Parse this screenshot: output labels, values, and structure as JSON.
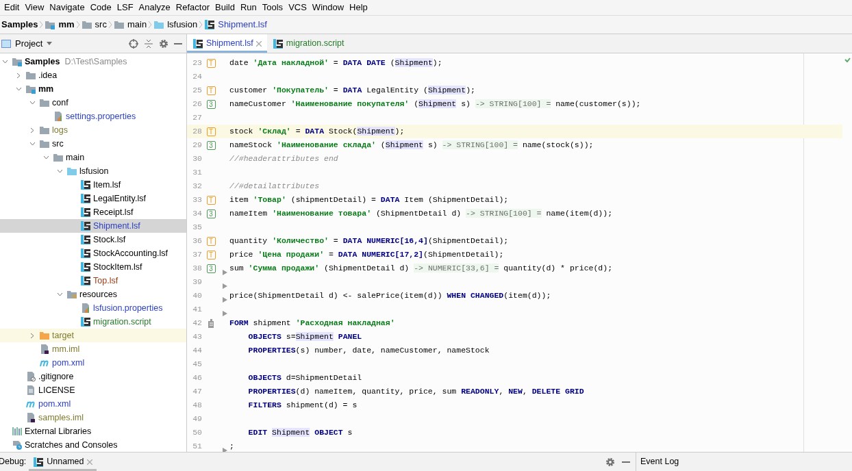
{
  "menu": [
    "Edit",
    "View",
    "Navigate",
    "Code",
    "LSF",
    "Analyze",
    "Refactor",
    "Build",
    "Run",
    "Tools",
    "VCS",
    "Window",
    "Help"
  ],
  "breadcrumbs": [
    {
      "label": "Samples",
      "kind": "plain",
      "bold": true
    },
    {
      "label": "mm",
      "kind": "module",
      "bold": true
    },
    {
      "label": "src",
      "kind": "folder",
      "bold": false
    },
    {
      "label": "main",
      "kind": "folder",
      "bold": false
    },
    {
      "label": "lsfusion",
      "kind": "source",
      "bold": false
    },
    {
      "label": "Shipment.lsf",
      "kind": "lsf",
      "bold": false
    }
  ],
  "project_panel": {
    "title": "Project",
    "tree": [
      {
        "label": "Samples",
        "path": "D:\\Test\\Samples",
        "kind": "module",
        "bold": true,
        "color": "#000000",
        "expanded": true,
        "selected": false,
        "excluded": false,
        "children": [
          {
            "label": ".idea",
            "kind": "folder",
            "bold": false,
            "color": "#000000",
            "expanded": false,
            "selected": false,
            "excluded": false
          },
          {
            "label": "mm",
            "kind": "module",
            "bold": true,
            "color": "#000000",
            "expanded": true,
            "selected": false,
            "excluded": false,
            "children": [
              {
                "label": "conf",
                "kind": "folder",
                "bold": false,
                "color": "#000000",
                "expanded": true,
                "selected": false,
                "excluded": false,
                "children": [
                  {
                    "label": "settings.properties",
                    "kind": "properties",
                    "bold": false,
                    "color": "#2a3fc2",
                    "selected": false,
                    "excluded": false
                  }
                ]
              },
              {
                "label": "logs",
                "kind": "folder",
                "bold": false,
                "color": "#7d7a2e",
                "expanded": false,
                "selected": false,
                "excluded": false
              },
              {
                "label": "src",
                "kind": "folder",
                "bold": false,
                "expanded": true,
                "selected": false,
                "excluded": false,
                "children": [
                  {
                    "label": "main",
                    "kind": "folder",
                    "bold": false,
                    "color": "#000000",
                    "expanded": true,
                    "selected": false,
                    "excluded": false,
                    "children": [
                      {
                        "label": "lsfusion",
                        "kind": "source",
                        "bold": false,
                        "expanded": true,
                        "selected": false,
                        "excluded": false,
                        "children": [
                          {
                            "label": "Item.lsf",
                            "kind": "lsf",
                            "bold": false,
                            "color": "#000000",
                            "selected": false,
                            "excluded": false
                          },
                          {
                            "label": "LegalEntity.lsf",
                            "kind": "lsf",
                            "bold": false,
                            "color": "#000000",
                            "selected": false,
                            "excluded": false
                          },
                          {
                            "label": "Receipt.lsf",
                            "kind": "lsf",
                            "bold": false,
                            "color": "#000000",
                            "selected": false,
                            "excluded": false
                          },
                          {
                            "label": "Shipment.lsf",
                            "kind": "lsf",
                            "bold": false,
                            "color": "#2a3fc2",
                            "selected": true,
                            "excluded": false
                          },
                          {
                            "label": "Stock.lsf",
                            "kind": "lsf",
                            "bold": false,
                            "color": "#000000",
                            "selected": false,
                            "excluded": false
                          },
                          {
                            "label": "StockAccounting.lsf",
                            "kind": "lsf",
                            "bold": false,
                            "color": "#000000",
                            "selected": false,
                            "excluded": false
                          },
                          {
                            "label": "StockItem.lsf",
                            "kind": "lsf",
                            "bold": false,
                            "color": "#000000",
                            "selected": false,
                            "excluded": false
                          },
                          {
                            "label": "Top.lsf",
                            "kind": "lsf",
                            "bold": false,
                            "color": "#9e3a12",
                            "selected": false,
                            "excluded": false
                          }
                        ]
                      },
                      {
                        "label": "resources",
                        "kind": "resources",
                        "bold": false,
                        "color": "#000000",
                        "expanded": true,
                        "selected": false,
                        "excluded": false,
                        "children": [
                          {
                            "label": "lsfusion.properties",
                            "kind": "properties",
                            "bold": false,
                            "color": "#2a3fc2",
                            "selected": false,
                            "excluded": false
                          },
                          {
                            "label": "migration.script",
                            "kind": "lsf",
                            "bold": false,
                            "color": "#267a2a",
                            "selected": false,
                            "excluded": false
                          }
                        ]
                      }
                    ]
                  }
                ]
              },
              {
                "label": "target",
                "kind": "output",
                "bold": false,
                "color": "#7d7a2e",
                "expanded": false,
                "selected": false,
                "excluded": true
              },
              {
                "label": "mm.iml",
                "kind": "iml",
                "bold": false,
                "color": "#7d7a2e",
                "selected": false,
                "excluded": false
              },
              {
                "label": "pom.xml",
                "kind": "maven",
                "bold": false,
                "color": "#2a3fc2",
                "selected": false,
                "excluded": false
              }
            ]
          },
          {
            "label": ".gitignore",
            "kind": "ignore",
            "bold": false,
            "color": "#000000",
            "selected": false,
            "excluded": false
          },
          {
            "label": "LICENSE",
            "kind": "text",
            "bold": false,
            "color": "#000000",
            "selected": false,
            "excluded": false
          },
          {
            "label": "pom.xml",
            "kind": "maven",
            "bold": false,
            "color": "#2a3fc2",
            "selected": false,
            "excluded": false
          },
          {
            "label": "samples.iml",
            "kind": "iml",
            "bold": false,
            "color": "#7d7a2e",
            "selected": false,
            "excluded": false
          }
        ]
      },
      {
        "label": "External Libraries",
        "kind": "libraries",
        "bold": false,
        "color": "#000000",
        "selected": false,
        "excluded": false
      },
      {
        "label": "Scratches and Consoles",
        "kind": "scratches",
        "bold": false,
        "color": "#000000",
        "selected": false,
        "excluded": false
      }
    ]
  },
  "editor_tabs": [
    {
      "label": "Shipment.lsf",
      "color": "#2a3fc2",
      "selected": true,
      "closable": true
    },
    {
      "label": "migration.script",
      "color": "#267a2a",
      "selected": false,
      "closable": false
    }
  ],
  "code": [
    {
      "number": "23",
      "marker": {
        "kind": "t",
        "text": "T"
      },
      "current": false,
      "indented": false,
      "arrow": false,
      "tokens": [
        {
          "kind": "id",
          "text": "date "
        },
        {
          "kind": "str",
          "text": "'Дата накладной'"
        },
        {
          "kind": "id",
          "text": " = "
        },
        {
          "kind": "kw",
          "text": "DATA DATE"
        },
        {
          "kind": "id",
          "text": " ("
        },
        {
          "kind": "ref",
          "text": "Shipment"
        },
        {
          "kind": "id",
          "text": ");"
        }
      ]
    },
    {
      "number": "24",
      "current": false,
      "arrow": false
    },
    {
      "number": "25",
      "marker": {
        "kind": "t",
        "text": "T"
      },
      "current": false,
      "indented": false,
      "arrow": false,
      "tokens": [
        {
          "kind": "id",
          "text": "customer "
        },
        {
          "kind": "str",
          "text": "'Покупатель'"
        },
        {
          "kind": "id",
          "text": " = "
        },
        {
          "kind": "kw",
          "text": "DATA"
        },
        {
          "kind": "id",
          "text": " LegalEntity ("
        },
        {
          "kind": "ref",
          "text": "Shipment"
        },
        {
          "kind": "id",
          "text": ");"
        }
      ]
    },
    {
      "number": "26",
      "marker": {
        "kind": "n",
        "text": "3"
      },
      "current": false,
      "indented": false,
      "arrow": false,
      "tokens": [
        {
          "kind": "id",
          "text": "nameCustomer "
        },
        {
          "kind": "str",
          "text": "'Наименование покупателя'"
        },
        {
          "kind": "id",
          "text": " ("
        },
        {
          "kind": "ref",
          "text": "Shipment"
        },
        {
          "kind": "id",
          "text": " s) "
        },
        {
          "kind": "hint",
          "text": "-> STRING[100] ="
        },
        {
          "kind": "id",
          "text": " name(customer(s));"
        }
      ]
    },
    {
      "number": "27",
      "current": false,
      "arrow": false
    },
    {
      "number": "28",
      "marker": {
        "kind": "t",
        "text": "T"
      },
      "current": true,
      "indented": false,
      "arrow": false,
      "tokens": [
        {
          "kind": "id",
          "text": "stock "
        },
        {
          "kind": "str",
          "text": "'Склад'"
        },
        {
          "kind": "id",
          "text": " = "
        },
        {
          "kind": "kw",
          "text": "DATA"
        },
        {
          "kind": "id",
          "text": " Stock("
        },
        {
          "kind": "ref",
          "text": "Shipment"
        },
        {
          "kind": "id",
          "text": ");"
        }
      ]
    },
    {
      "number": "29",
      "marker": {
        "kind": "n",
        "text": "3"
      },
      "current": false,
      "indented": false,
      "arrow": false,
      "tokens": [
        {
          "kind": "id",
          "text": "nameStock "
        },
        {
          "kind": "str",
          "text": "'Наименование склада'"
        },
        {
          "kind": "id",
          "text": " ("
        },
        {
          "kind": "ref",
          "text": "Shipment"
        },
        {
          "kind": "id",
          "text": " s) "
        },
        {
          "kind": "hint",
          "text": "-> STRING[100] ="
        },
        {
          "kind": "id",
          "text": " name(stock(s));"
        }
      ]
    },
    {
      "number": "30",
      "current": false,
      "indented": false,
      "arrow": false,
      "tokens": [
        {
          "kind": "cm",
          "text": "//#headerattributes end"
        }
      ]
    },
    {
      "number": "31",
      "current": false,
      "arrow": false
    },
    {
      "number": "32",
      "current": false,
      "indented": false,
      "arrow": false,
      "tokens": [
        {
          "kind": "cm",
          "text": "//#detailattributes"
        }
      ]
    },
    {
      "number": "33",
      "marker": {
        "kind": "t",
        "text": "T"
      },
      "current": false,
      "indented": false,
      "arrow": false,
      "tokens": [
        {
          "kind": "id",
          "text": "item "
        },
        {
          "kind": "str",
          "text": "'Товар'"
        },
        {
          "kind": "id",
          "text": " (shipmentDetail) = "
        },
        {
          "kind": "kw",
          "text": "DATA"
        },
        {
          "kind": "id",
          "text": " Item (ShipmentDetail);"
        }
      ]
    },
    {
      "number": "34",
      "marker": {
        "kind": "n",
        "text": "3"
      },
      "current": false,
      "indented": false,
      "arrow": false,
      "tokens": [
        {
          "kind": "id",
          "text": "nameItem "
        },
        {
          "kind": "str",
          "text": "'Наименование товара'"
        },
        {
          "kind": "id",
          "text": " (ShipmentDetail d) "
        },
        {
          "kind": "hint",
          "text": "-> STRING[100] ="
        },
        {
          "kind": "id",
          "text": " name(item(d));"
        }
      ]
    },
    {
      "number": "35",
      "current": false,
      "arrow": false
    },
    {
      "number": "36",
      "marker": {
        "kind": "t",
        "text": "T"
      },
      "current": false,
      "indented": false,
      "arrow": false,
      "tokens": [
        {
          "kind": "id",
          "text": "quantity "
        },
        {
          "kind": "str",
          "text": "'Количество'"
        },
        {
          "kind": "id",
          "text": " = "
        },
        {
          "kind": "kw",
          "text": "DATA NUMERIC[16,4]"
        },
        {
          "kind": "id",
          "text": "(ShipmentDetail);"
        }
      ]
    },
    {
      "number": "37",
      "marker": {
        "kind": "t",
        "text": "T"
      },
      "current": false,
      "indented": false,
      "arrow": false,
      "tokens": [
        {
          "kind": "id",
          "text": "price "
        },
        {
          "kind": "str",
          "text": "'Цена продажи'"
        },
        {
          "kind": "id",
          "text": " = "
        },
        {
          "kind": "kw",
          "text": "DATA NUMERIC[17,2]"
        },
        {
          "kind": "id",
          "text": "(ShipmentDetail);"
        }
      ]
    },
    {
      "number": "38",
      "marker": {
        "kind": "n",
        "text": "3"
      },
      "current": false,
      "indented": false,
      "arrow": true,
      "tokens": [
        {
          "kind": "id",
          "text": "sum "
        },
        {
          "kind": "str",
          "text": "'Сумма продажи'"
        },
        {
          "kind": "id",
          "text": " (ShipmentDetail d) "
        },
        {
          "kind": "hint",
          "text": "-> NUMERIC[33,6] ="
        },
        {
          "kind": "id",
          "text": " quantity(d) * price(d);"
        }
      ]
    },
    {
      "number": "39",
      "current": false,
      "arrow": true
    },
    {
      "number": "40",
      "current": false,
      "indented": false,
      "arrow": true,
      "tokens": [
        {
          "kind": "id",
          "text": "price(ShipmentDetail d) <- salePrice(item(d)) "
        },
        {
          "kind": "kw",
          "text": "WHEN CHANGED"
        },
        {
          "kind": "id",
          "text": "(item(d));"
        }
      ]
    },
    {
      "number": "41",
      "current": false,
      "arrow": true
    },
    {
      "number": "42",
      "marker": {
        "kind": "form"
      },
      "current": false,
      "indented": false,
      "arrow": false,
      "tokens": [
        {
          "kind": "kw",
          "text": "FORM"
        },
        {
          "kind": "id",
          "text": " shipment "
        },
        {
          "kind": "str",
          "text": "'Расходная накладная'"
        }
      ]
    },
    {
      "number": "43",
      "current": false,
      "indented": true,
      "arrow": false,
      "tokens": [
        {
          "kind": "kw",
          "text": "OBJECTS"
        },
        {
          "kind": "id",
          "text": " s="
        },
        {
          "kind": "ref",
          "text": "Shipment"
        },
        {
          "kind": "kw",
          "text": " PANEL"
        }
      ]
    },
    {
      "number": "44",
      "current": false,
      "indented": true,
      "arrow": false,
      "tokens": [
        {
          "kind": "kw",
          "text": "PROPERTIES"
        },
        {
          "kind": "id",
          "text": "(s) number, date, nameCustomer, nameStock"
        }
      ]
    },
    {
      "number": "45",
      "current": false,
      "arrow": false
    },
    {
      "number": "46",
      "current": false,
      "indented": true,
      "arrow": false,
      "tokens": [
        {
          "kind": "kw",
          "text": "OBJECTS"
        },
        {
          "kind": "id",
          "text": " d=ShipmentDetail"
        }
      ]
    },
    {
      "number": "47",
      "current": false,
      "indented": true,
      "arrow": false,
      "tokens": [
        {
          "kind": "kw",
          "text": "PROPERTIES"
        },
        {
          "kind": "id",
          "text": "(d) nameItem, quantity, price, sum "
        },
        {
          "kind": "kw",
          "text": "READONLY"
        },
        {
          "kind": "id",
          "text": ", "
        },
        {
          "kind": "kw",
          "text": "NEW"
        },
        {
          "kind": "id",
          "text": ", "
        },
        {
          "kind": "kw",
          "text": "DELETE GRID"
        }
      ]
    },
    {
      "number": "48",
      "current": false,
      "indented": true,
      "arrow": false,
      "tokens": [
        {
          "kind": "kw",
          "text": "FILTERS"
        },
        {
          "kind": "id",
          "text": " shipment(d) = s"
        }
      ]
    },
    {
      "number": "49",
      "current": false,
      "arrow": false
    },
    {
      "number": "50",
      "current": false,
      "indented": true,
      "arrow": false,
      "tokens": [
        {
          "kind": "kw",
          "text": "EDIT "
        },
        {
          "kind": "ref",
          "text": "Shipment"
        },
        {
          "kind": "kw",
          "text": " OBJECT"
        },
        {
          "kind": "id",
          "text": " s"
        }
      ]
    },
    {
      "number": "51",
      "current": false,
      "indented": false,
      "arrow": true,
      "tokens": [
        {
          "kind": "id",
          "text": ";"
        }
      ]
    }
  ],
  "bottom_bar": {
    "label": "Debug:",
    "tab": {
      "label": "Unnamed",
      "selected": true
    },
    "event_log": "Event Log"
  }
}
